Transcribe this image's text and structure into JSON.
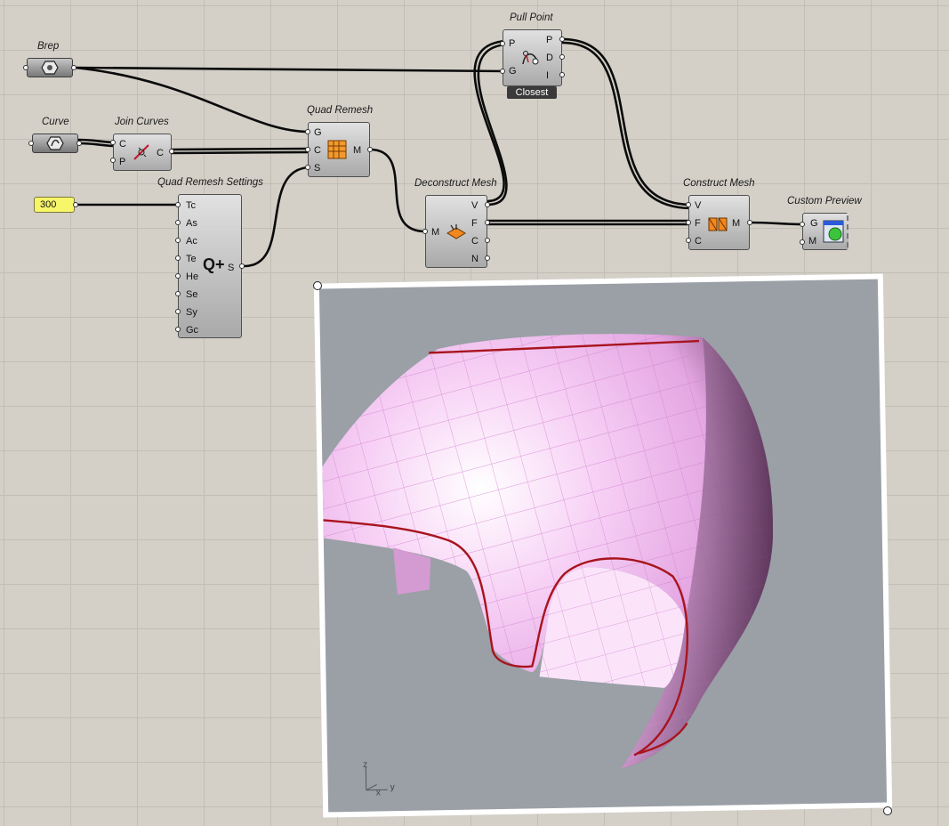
{
  "components": {
    "brep": {
      "title": "Brep"
    },
    "curve": {
      "title": "Curve"
    },
    "join_curves": {
      "title": "Join Curves",
      "inputs": [
        "C",
        "P"
      ],
      "outputs": [
        "C"
      ]
    },
    "quad_remesh": {
      "title": "Quad Remesh",
      "inputs": [
        "G",
        "C",
        "S"
      ],
      "outputs": [
        "M"
      ]
    },
    "quad_remesh_settings": {
      "title": "Quad Remesh Settings",
      "inputs": [
        "Tc",
        "As",
        "Ac",
        "Te",
        "He",
        "Se",
        "Sy",
        "Gc"
      ],
      "outputs": [
        "S"
      ],
      "icon_text": "Q+"
    },
    "pull_point": {
      "title": "Pull Point",
      "inputs": [
        "P",
        "G"
      ],
      "outputs": [
        "P",
        "D",
        "I"
      ],
      "tag": "Closest"
    },
    "deconstruct_mesh": {
      "title": "Deconstruct Mesh",
      "inputs": [
        "M"
      ],
      "outputs": [
        "V",
        "F",
        "C",
        "N"
      ]
    },
    "construct_mesh": {
      "title": "Construct Mesh",
      "inputs": [
        "V",
        "F",
        "C"
      ],
      "outputs": [
        "M"
      ]
    },
    "custom_preview": {
      "title": "Custom Preview",
      "inputs": [
        "G",
        "M"
      ]
    }
  },
  "slider": {
    "value": "300"
  },
  "viewport": {
    "axes": {
      "z": "z",
      "y": "y",
      "x": "x"
    },
    "mesh_color": "#f2b8f0",
    "curve_color": "#a8141e",
    "background": "#9aa0a6"
  },
  "colors": {
    "canvas": "#d4d0c8",
    "grid": "#c2beb6",
    "slider": "#f7f56a",
    "wire": "#000000"
  }
}
